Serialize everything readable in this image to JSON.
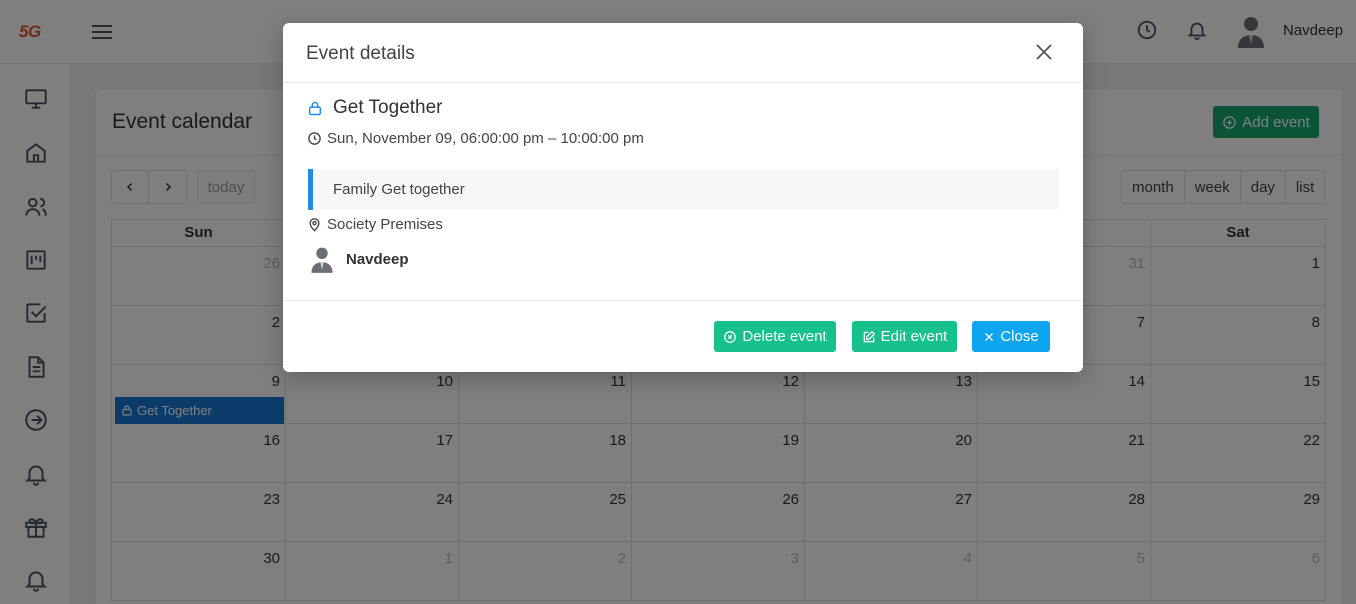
{
  "app": {
    "logo": "5G"
  },
  "topbar": {
    "user_name": "Navdeep"
  },
  "sidebar": {
    "icons": [
      "monitor-icon",
      "home-icon",
      "users-icon",
      "board-icon",
      "checkbox-icon",
      "document-icon",
      "arrow-right-circle-icon",
      "bell-icon",
      "gift-icon",
      "bell-icon"
    ]
  },
  "calendar": {
    "title": "Event calendar",
    "add_event_label": "Add event",
    "today_label": "today",
    "views": [
      "month",
      "week",
      "day",
      "list"
    ],
    "weekdays": [
      "Sun",
      "",
      "",
      "",
      "",
      "",
      "Sat"
    ],
    "weeks": [
      [
        {
          "d": "26",
          "other": true
        },
        {
          "d": "",
          "other": false
        },
        {
          "d": "",
          "other": false
        },
        {
          "d": "",
          "other": false
        },
        {
          "d": "",
          "other": false
        },
        {
          "d": "31",
          "other": true
        },
        {
          "d": "1",
          "other": false
        }
      ],
      [
        {
          "d": "2",
          "other": false
        },
        {
          "d": "",
          "other": false
        },
        {
          "d": "",
          "other": false
        },
        {
          "d": "",
          "other": false
        },
        {
          "d": "",
          "other": false
        },
        {
          "d": "7",
          "other": false
        },
        {
          "d": "8",
          "other": false
        }
      ],
      [
        {
          "d": "9",
          "other": false
        },
        {
          "d": "10",
          "other": false
        },
        {
          "d": "11",
          "other": false
        },
        {
          "d": "12",
          "other": false
        },
        {
          "d": "13",
          "other": false
        },
        {
          "d": "14",
          "other": false
        },
        {
          "d": "15",
          "other": false
        }
      ],
      [
        {
          "d": "16",
          "other": false
        },
        {
          "d": "17",
          "other": false
        },
        {
          "d": "18",
          "other": false
        },
        {
          "d": "19",
          "other": false
        },
        {
          "d": "20",
          "other": false
        },
        {
          "d": "21",
          "other": false
        },
        {
          "d": "22",
          "other": false
        }
      ],
      [
        {
          "d": "23",
          "other": false
        },
        {
          "d": "24",
          "other": false
        },
        {
          "d": "25",
          "other": false
        },
        {
          "d": "26",
          "other": false
        },
        {
          "d": "27",
          "other": false
        },
        {
          "d": "28",
          "other": false
        },
        {
          "d": "29",
          "other": false
        }
      ],
      [
        {
          "d": "30",
          "other": false
        },
        {
          "d": "1",
          "other": true
        },
        {
          "d": "2",
          "other": true
        },
        {
          "d": "3",
          "other": true
        },
        {
          "d": "4",
          "other": true
        },
        {
          "d": "5",
          "other": true
        },
        {
          "d": "6",
          "other": true
        }
      ]
    ],
    "event_chip": {
      "label": "Get Together",
      "week": 2,
      "day": 0
    }
  },
  "modal": {
    "title": "Event details",
    "event_title": "Get Together",
    "datetime": "Sun, November 09, 06:00:00 pm – 10:00:00 pm",
    "description": "Family Get together",
    "location": "Society Premises",
    "organizer": "Navdeep",
    "delete_label": "Delete event",
    "edit_label": "Edit event",
    "close_label": "Close"
  },
  "colors": {
    "brand": "#e0562a",
    "add_button": "#16a870",
    "success_button": "#17c18c",
    "close_button": "#0ea5f0",
    "event_chip": "#1678d2",
    "desc_accent": "#1f8de8"
  }
}
